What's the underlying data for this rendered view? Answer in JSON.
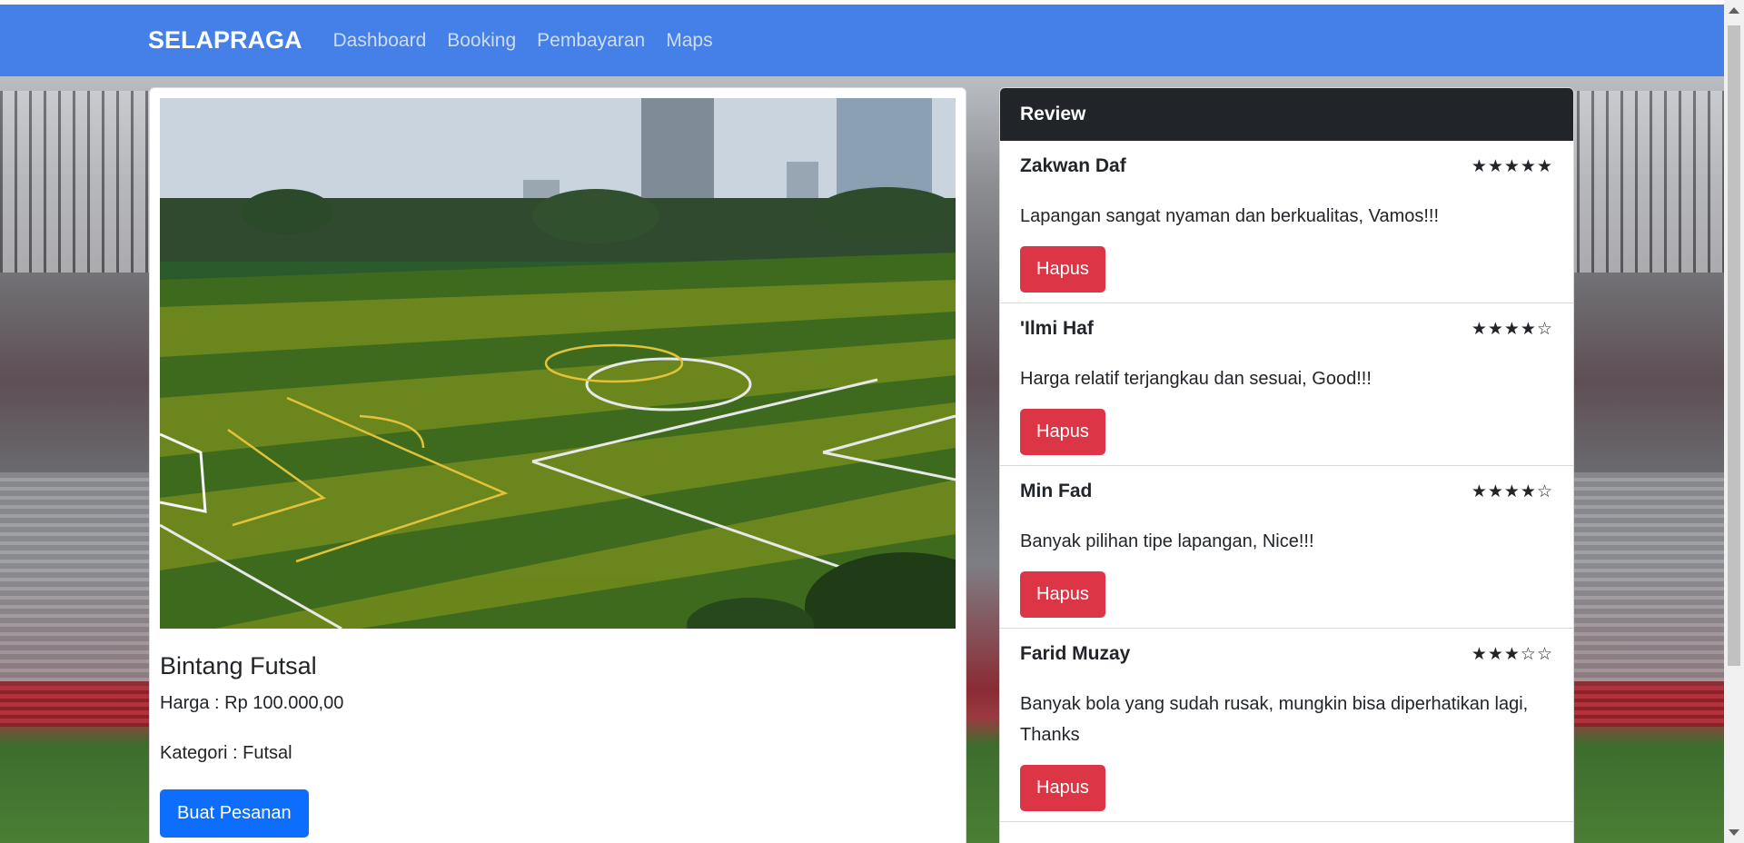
{
  "navbar": {
    "brand": "SELAPRAGA",
    "links": [
      "Dashboard",
      "Booking",
      "Pembayaran",
      "Maps"
    ]
  },
  "product": {
    "title": "Bintang Futsal",
    "price": "Harga : Rp 100.000,00",
    "category": "Kategori : Futsal",
    "order_button": "Buat Pesanan"
  },
  "reviews": {
    "header": "Review",
    "delete_label": "Hapus",
    "items": [
      {
        "name": "Zakwan Daf",
        "stars": "★★★★★",
        "rating": 5,
        "text": "Lapangan sangat nyaman dan berkualitas, Vamos!!!"
      },
      {
        "name": "'Ilmi Haf",
        "stars": "★★★★☆",
        "rating": 4,
        "text": "Harga relatif terjangkau dan sesuai, Good!!!"
      },
      {
        "name": "Min Fad",
        "stars": "★★★★☆",
        "rating": 4,
        "text": "Banyak pilihan tipe lapangan, Nice!!!"
      },
      {
        "name": "Farid Muzay",
        "stars": "★★★☆☆",
        "rating": 3,
        "text": "Banyak bola yang sudah rusak, mungkin bisa diperhatikan lagi, Thanks"
      }
    ]
  },
  "colors": {
    "navbar": "#4580e9",
    "primary": "#0d6efd",
    "danger": "#dc3545",
    "review_header": "#212529"
  }
}
